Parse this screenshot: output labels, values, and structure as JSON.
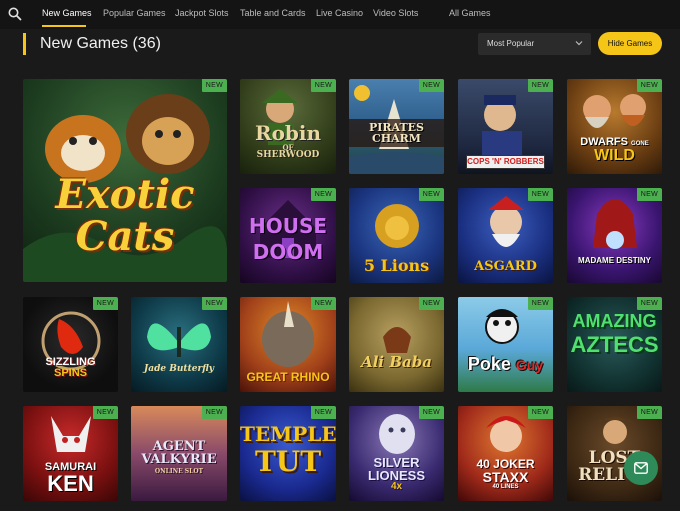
{
  "nav": {
    "items": [
      "New Games",
      "Popular Games",
      "Jackpot Slots",
      "Table and Cards",
      "Live Casino",
      "Video Slots",
      "All Games"
    ]
  },
  "header": {
    "title": "New Games (36)",
    "sort_value": "Most Popular",
    "hide_label": "Hide Games"
  },
  "badge_label": "NEW",
  "games": [
    {
      "name": "Exotic Cats"
    },
    {
      "name": "Robin of Sherwood"
    },
    {
      "name": "Pirates Charm"
    },
    {
      "name": "Cops 'N' Robbers"
    },
    {
      "name": "Dwarfs Gone Wild"
    },
    {
      "name": "House of Doom"
    },
    {
      "name": "5 Lions"
    },
    {
      "name": "Asgard"
    },
    {
      "name": "Madame Destiny"
    },
    {
      "name": "Sizzling Spins"
    },
    {
      "name": "Jade Butterfly"
    },
    {
      "name": "Great Rhino"
    },
    {
      "name": "Ali Baba"
    },
    {
      "name": "Poke the Guy"
    },
    {
      "name": "Amazing Aztecs"
    },
    {
      "name": "Samurai Ken"
    },
    {
      "name": "Agent Valkyrie"
    },
    {
      "name": "Temple of Tut"
    },
    {
      "name": "Silver Lioness 4x"
    },
    {
      "name": "40 Joker Staxx"
    },
    {
      "name": "Lost Relics"
    }
  ],
  "tile_text": {
    "exotic": [
      "Exotic",
      "Cats"
    ],
    "robin": [
      "Robin",
      "OF",
      "SHERWOOD"
    ],
    "pirates": [
      "PIRATES",
      "CHARM"
    ],
    "cops": "COPS 'N' ROBBERS",
    "dwarfs": [
      "DWARFS",
      "GONE",
      "WILD"
    ],
    "house": [
      "HOUSE",
      "DOOM"
    ],
    "lions": "5 Lions",
    "asgard": "ASGARD",
    "madame": "MADAME DESTINY",
    "sizzling": [
      "SIZZLING",
      "SPINS"
    ],
    "jade": "Jade Butterfly",
    "rhino": "GREAT RHINO",
    "alibaba": "Ali Baba",
    "poke": [
      "Poke",
      "Guy"
    ],
    "aztecs": [
      "AMAZING",
      "AZTECS"
    ],
    "samurai": [
      "SAMURAI",
      "KEN"
    ],
    "valkyrie": [
      "AGENT",
      "VALKYRIE",
      "ONLINE SLOT"
    ],
    "tut": [
      "TEMPLE",
      "TUT"
    ],
    "lioness": [
      "SILVER",
      "LIONESS",
      "4x"
    ],
    "joker": [
      "40 JOKER",
      "STAXX",
      "40 LINES"
    ],
    "lost": [
      "LOST",
      "RELICS"
    ]
  },
  "colors": {
    "accent": "#f5c518",
    "badge": "#4caf50",
    "background": "#1a1a1a",
    "chat": "#2f8a5a"
  },
  "icons": [
    "search-icon",
    "chevron-down-icon",
    "chat-icon"
  ]
}
